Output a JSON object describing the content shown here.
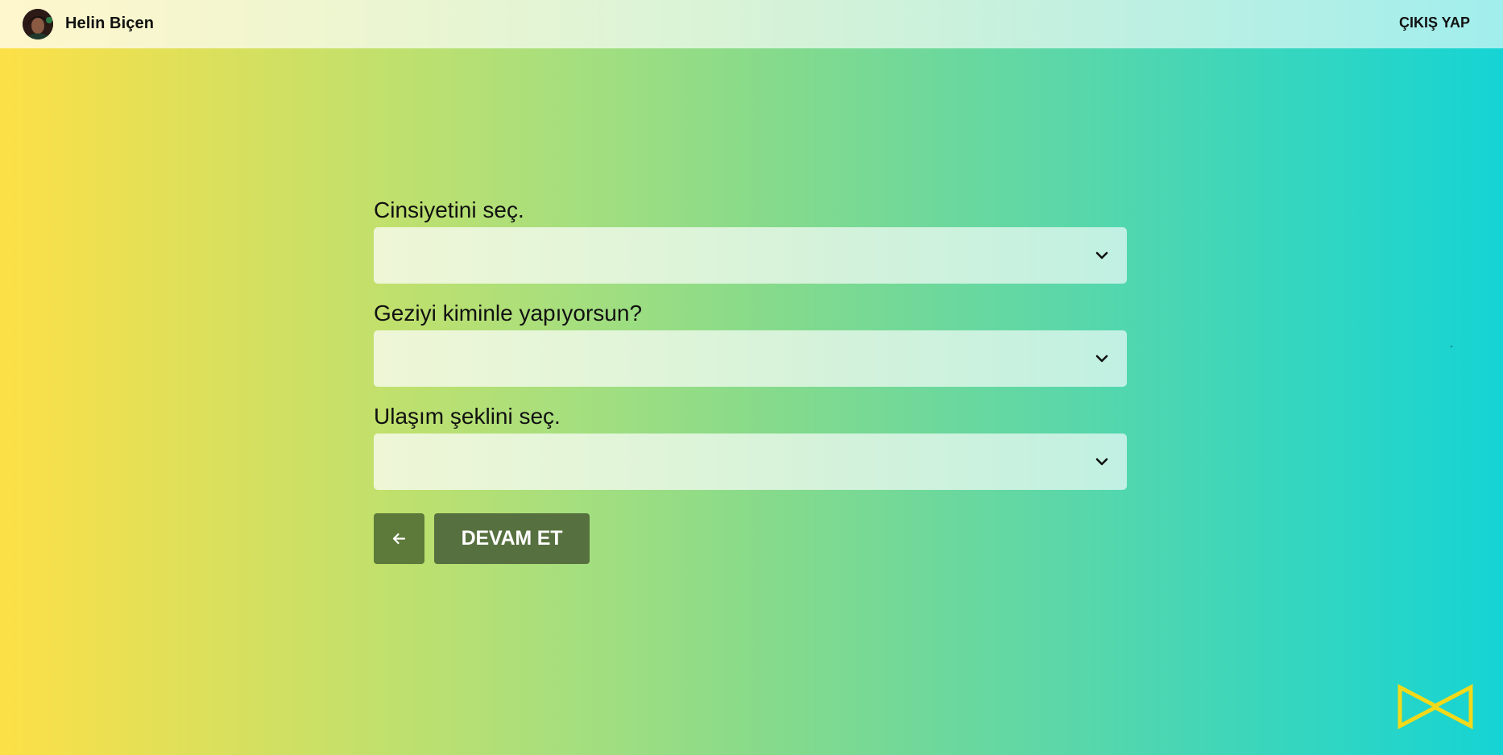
{
  "header": {
    "user_name": "Helin Biçen",
    "logout_label": "ÇIKIŞ YAP"
  },
  "form": {
    "fields": [
      {
        "label": "Cinsiyetini seç.",
        "value": "",
        "icon": "chevron-down-icon"
      },
      {
        "label": "Geziyi kiminle yapıyorsun?",
        "value": "",
        "icon": "chevron-down-icon"
      },
      {
        "label": "Ulaşım şeklini seç.",
        "value": "",
        "icon": "chevron-down-icon"
      }
    ],
    "back_icon": "arrow-left-icon",
    "continue_label": "DEVAM ET"
  },
  "colors": {
    "gradient_start": "#fde047",
    "gradient_end": "#15d4d4",
    "button": "#57703f",
    "logo": "#f2d91a"
  }
}
